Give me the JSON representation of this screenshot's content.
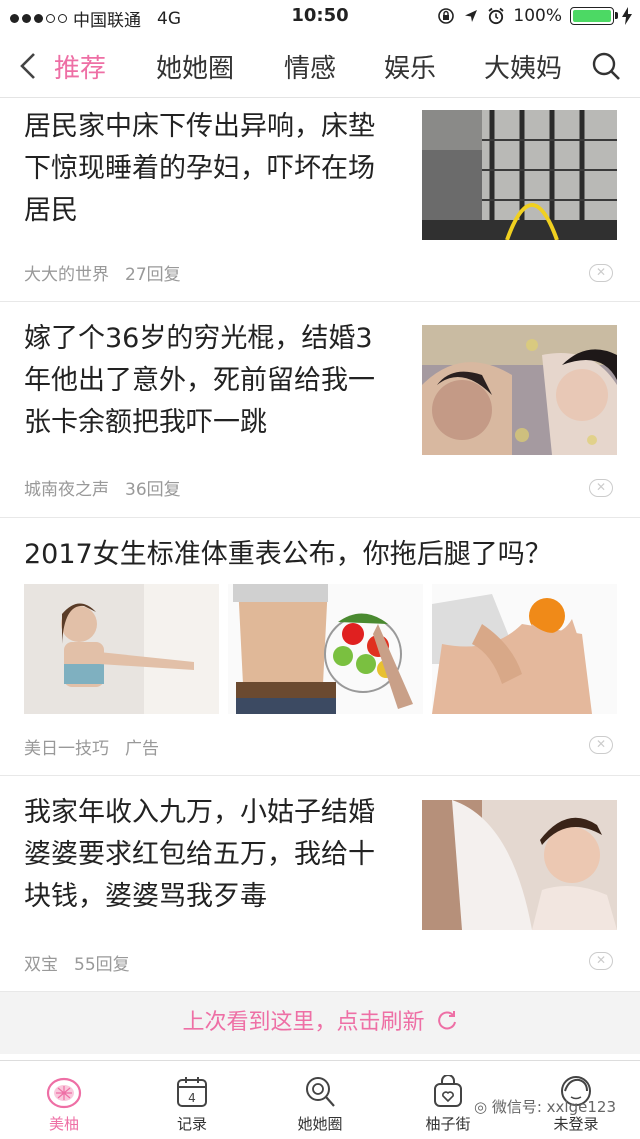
{
  "status": {
    "carrier": "中国联通",
    "network": "4G",
    "time": "10:50",
    "battery": "100%",
    "battery_level": 1.0
  },
  "nav": {
    "tabs": [
      "推荐",
      "她她圈",
      "情感",
      "娱乐",
      "大姨妈"
    ],
    "active_tab": 0
  },
  "feed": [
    {
      "title": "居民家中床下传出异响，床垫下惊现睡着的孕妇，吓坏在场居民",
      "author": "大大的世界",
      "replies": "27回复"
    },
    {
      "title": "嫁了个36岁的穷光棍，结婚3年他出了意外，死前留给我一张卡余额把我吓一跳",
      "author": "城南夜之声",
      "replies": "36回复"
    },
    {
      "title": "2017女生标准体重表公布，你拖后腿了吗？",
      "author": "美日一技巧",
      "replies": "广告"
    },
    {
      "title": "我家年收入九万，小姑子结婚婆婆要求红包给五万，我给十块钱，婆婆骂我歹毒",
      "author": "双宝",
      "replies": "55回复"
    }
  ],
  "refresh_label": "上次看到这里，点击刷新",
  "tabbar": {
    "items": [
      "美柚",
      "记录",
      "她她圈",
      "柚子街",
      "未登录"
    ],
    "active": 0,
    "calendar_day": "4"
  },
  "watermark": "微信号: xxlge123",
  "colors": {
    "accent": "#ee6fa5"
  }
}
